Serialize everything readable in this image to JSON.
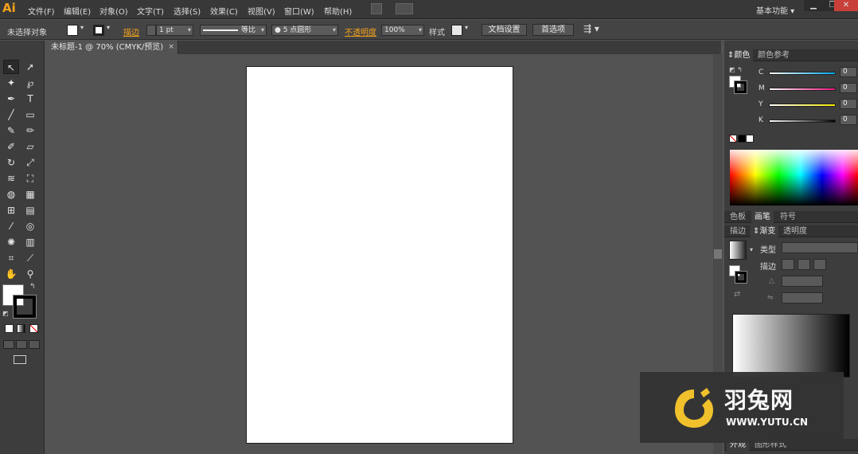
{
  "app": {
    "logo": "Ai"
  },
  "menu": [
    "文件(F)",
    "编辑(E)",
    "对象(O)",
    "文字(T)",
    "选择(S)",
    "效果(C)",
    "视图(V)",
    "窗口(W)",
    "帮助(H)"
  ],
  "workspace": {
    "label": "基本功能"
  },
  "window_controls": {
    "minimize": "▁",
    "restore": "❐",
    "close": "✕"
  },
  "control_bar": {
    "selection_status": "未选择对象",
    "stroke_label": "描边",
    "stroke_weight": "1 pt",
    "stroke_profile": "等比",
    "brush": "5 点圆形",
    "opacity_label": "不透明度",
    "opacity_value": "100%",
    "style_label": "样式",
    "doc_setup_button": "文档设置",
    "preferences_button": "首选项"
  },
  "document": {
    "tab_title": "未标题-1 @ 70% (CMYK/预览)",
    "close": "×"
  },
  "panels": {
    "color": {
      "tabs": [
        "颜色",
        "颜色参考"
      ],
      "channels": [
        {
          "name": "C",
          "value": "0",
          "color": "#00a6e8"
        },
        {
          "name": "M",
          "value": "0",
          "color": "#e8127f"
        },
        {
          "name": "Y",
          "value": "0",
          "color": "#f5e800"
        },
        {
          "name": "K",
          "value": "0",
          "color": "#000000"
        }
      ]
    },
    "swatch_tabs": [
      "色板",
      "画笔",
      "符号"
    ],
    "gradient": {
      "tabs": [
        "描边",
        "渐变",
        "透明度"
      ],
      "type_label": "类型",
      "stroke_label": "描边"
    },
    "bottom_tabs": [
      "外观",
      "图形样式"
    ]
  },
  "watermark": {
    "brand": "羽兔网",
    "url": "WWW.YUTU.CN"
  }
}
